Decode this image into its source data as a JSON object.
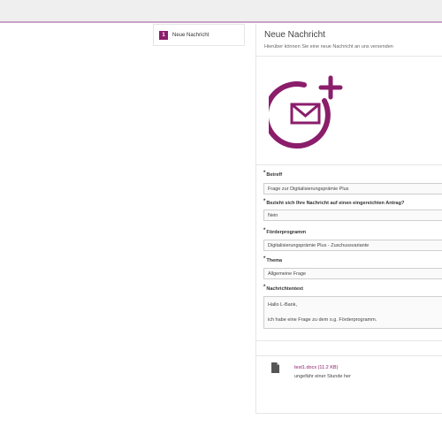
{
  "steps": [
    {
      "number": "1",
      "label": "Neue Nachricht"
    }
  ],
  "panel": {
    "title": "Neue Nachricht",
    "subtitle": "Hierüber können Sie eine neue Nachricht an uns versenden",
    "hero_icon": "mail-add-icon",
    "accent_color": "#8b1d6b"
  },
  "form": {
    "betreff": {
      "label": "Betreff",
      "value": "Frage zur Digitalisierungsprämie Plus"
    },
    "antrag": {
      "label": "Bezieht sich Ihre Nachricht auf einen eingereichten Antrag?",
      "value": "Nein"
    },
    "foerderprogramm": {
      "label": "Förderprogramm",
      "value": "Digitalisierungsprämie Plus - Zuschussvariante"
    },
    "thema": {
      "label": "Thema",
      "value": "Allgemeine Frage"
    },
    "nachricht": {
      "label": "Nachrichtentext",
      "line1": "Hallo L-Bank,",
      "line2": "ich habe eine Frage zu dem o.g. Förderprogramm."
    },
    "required_marker": "*"
  },
  "attachment": {
    "icon": "file-icon",
    "name": "test1.docx (11.2 KB)",
    "time": "ungefähr einer Stunde her"
  }
}
